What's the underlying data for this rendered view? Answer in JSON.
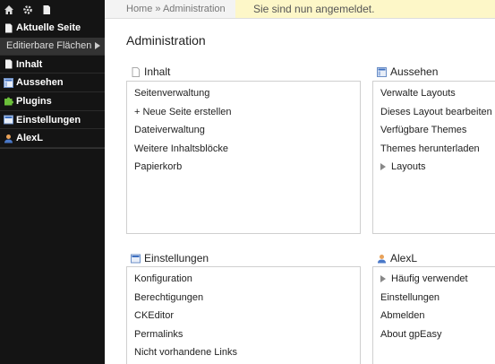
{
  "sidebar": {
    "items": [
      {
        "label": "Aktuelle Seite",
        "icon": "page-icon"
      },
      {
        "label": "Inhalt",
        "icon": "page-icon"
      },
      {
        "label": "Aussehen",
        "icon": "layout-icon"
      },
      {
        "label": "Plugins",
        "icon": "puzzle-icon"
      },
      {
        "label": "Einstellungen",
        "icon": "settings-window-icon"
      },
      {
        "label": "AlexL",
        "icon": "user-icon"
      }
    ],
    "sub_item": "Editierbare Flächen"
  },
  "topbar": {
    "breadcrumb_home": "Home",
    "breadcrumb_sep": " » ",
    "breadcrumb_current": "Administration",
    "notice": "Sie sind nun angemeldet."
  },
  "main": {
    "title": "Administration",
    "panels": [
      {
        "title": "Inhalt",
        "icon": "page-icon",
        "links": [
          "Seitenverwaltung",
          "+ Neue Seite erstellen",
          "Dateiverwaltung",
          "Weitere Inhaltsblöcke",
          "Papierkorb"
        ]
      },
      {
        "title": "Aussehen",
        "icon": "layout-icon",
        "links": [
          "Verwalte Layouts",
          "Dieses Layout bearbeiten",
          "Verfügbare Themes",
          "Themes herunterladen",
          "Layouts"
        ]
      },
      {
        "title": "Einstellungen",
        "icon": "settings-window-icon",
        "links": [
          "Konfiguration",
          "Berechtigungen",
          "CKEditor",
          "Permalinks",
          "Nicht vorhandene Links"
        ]
      },
      {
        "title": "AlexL",
        "icon": "user-icon",
        "links": [
          "Häufig verwendet",
          "Einstellungen",
          "Abmelden",
          "About gpEasy"
        ]
      }
    ]
  },
  "colors": {
    "sidebar_bg": "#141414",
    "notice_bg": "#fdf7c8",
    "panel_border": "#cfcfcf"
  }
}
